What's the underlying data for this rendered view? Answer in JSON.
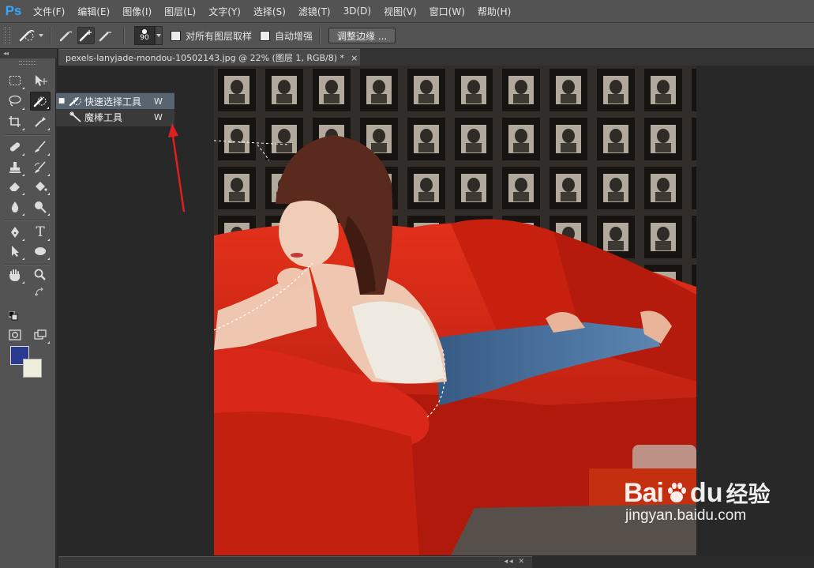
{
  "app": {
    "logo": "Ps"
  },
  "menu": [
    "文件(F)",
    "编辑(E)",
    "图像(I)",
    "图层(L)",
    "文字(Y)",
    "选择(S)",
    "滤镜(T)",
    "3D(D)",
    "视图(V)",
    "窗口(W)",
    "帮助(H)"
  ],
  "options": {
    "brush_size": "90",
    "sample_all_layers": "对所有图层取样",
    "auto_enhance": "自动增强",
    "refine_edge": "调整边缘 ..."
  },
  "document": {
    "tab_title": "pexels-lanyjade-mondou-10502143.jpg @ 22% (图层 1, RGB/8) *",
    "tab_close": "×"
  },
  "toolbox": {
    "fg_color": "#2a3a8f",
    "bg_color": "#efeedc",
    "type_tool_glyph": "T"
  },
  "flyout": {
    "items": [
      {
        "label": "快速选择工具",
        "shortcut": "W",
        "selected": true,
        "bullet": "■"
      },
      {
        "label": "魔棒工具",
        "shortcut": "W",
        "selected": false,
        "bullet": ""
      }
    ]
  },
  "watermark": {
    "brand_left": "Bai",
    "brand_right": "du",
    "brand_cn": "经验",
    "url": "jingyan.baidu.com"
  },
  "colors": {
    "annotation_arrow": "#e02020",
    "selected_row": "#596470",
    "ps_blue": "#31a8ff"
  }
}
